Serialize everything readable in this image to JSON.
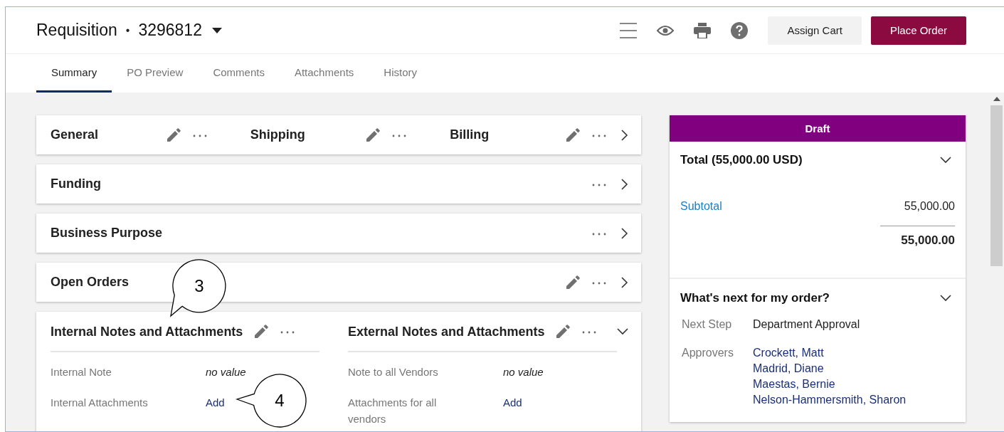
{
  "header": {
    "title": "Requisition",
    "separator": "•",
    "number": "3296812",
    "buttons": [
      {
        "label": "Assign Cart",
        "kind": "secondary"
      },
      {
        "label": "Place Order",
        "kind": "primary"
      }
    ]
  },
  "tabs": [
    {
      "label": "Summary",
      "selected": true
    },
    {
      "label": "PO Preview",
      "selected": false
    },
    {
      "label": "Comments",
      "selected": false
    },
    {
      "label": "Attachments",
      "selected": false
    },
    {
      "label": "History",
      "selected": false
    }
  ],
  "panels": [
    {
      "expanded": false,
      "sections": [
        {
          "title": "General",
          "editable": true
        },
        {
          "title": "Shipping",
          "editable": true
        },
        {
          "title": "Billing",
          "editable": true
        }
      ]
    },
    {
      "expanded": false,
      "sections": [
        {
          "title": "Funding",
          "editable": false
        }
      ]
    },
    {
      "expanded": false,
      "sections": [
        {
          "title": "Business Purpose",
          "editable": false
        }
      ]
    },
    {
      "expanded": false,
      "sections": [
        {
          "title": "Open Orders",
          "editable": true
        }
      ]
    },
    {
      "expanded": true,
      "sections": [
        {
          "title": "Internal Notes and Attachments",
          "editable": true,
          "fields": [
            {
              "label": "Internal Note",
              "value": "no value",
              "kind": "empty"
            },
            {
              "label": "Internal Attachments",
              "value": "Add",
              "kind": "link"
            }
          ]
        },
        {
          "title": "External Notes and Attachments",
          "editable": true,
          "fields": [
            {
              "label": "Note to all Vendors",
              "value": "no value",
              "kind": "empty"
            },
            {
              "label": "Attachments for all vendors",
              "value": "Add",
              "kind": "link"
            }
          ]
        }
      ]
    }
  ],
  "summary": {
    "status": "Draft",
    "total": {
      "title": "Total (55,000.00 USD)",
      "expanded": true,
      "subtotal_label": "Subtotal",
      "subtotal": "55,000.00",
      "total": "55,000.00"
    },
    "next": {
      "title": "What's next for my order?",
      "expanded": true,
      "next_step_label": "Next Step",
      "next_step": "Department Approval",
      "approvers_label": "Approvers",
      "approvers": [
        "Crockett, Matt",
        "Madrid, Diane",
        "Maestas, Bernie",
        "Nelson-Hammersmith, Sharon"
      ]
    }
  },
  "callouts": [
    {
      "label": "3"
    },
    {
      "label": "4"
    }
  ]
}
